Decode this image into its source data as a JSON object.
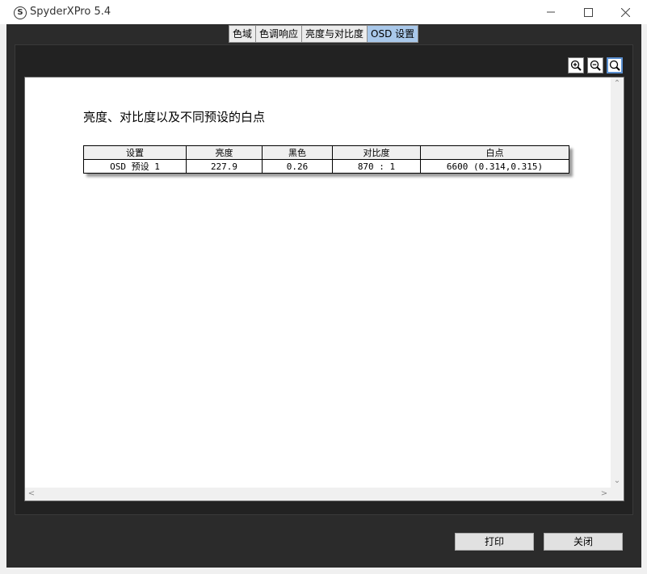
{
  "window": {
    "title": "SpyderXPro 5.4",
    "logo_letter": "S",
    "controls": [
      "minimize-icon",
      "maximize-icon",
      "close-icon"
    ]
  },
  "tabs": [
    {
      "label": "色域",
      "active": false
    },
    {
      "label": "色调响应",
      "active": false
    },
    {
      "label": "亮度与对比度",
      "active": false
    },
    {
      "label": "OSD 设置",
      "active": true
    }
  ],
  "zoom": {
    "icons": [
      "zoom-in-icon",
      "zoom-out-icon",
      "zoom-fit-icon"
    ]
  },
  "report": {
    "title": "亮度、对比度以及不同预设的白点",
    "table": {
      "headers": [
        "设置",
        "亮度",
        "黑色",
        "对比度",
        "白点"
      ],
      "rows": [
        [
          "OSD 预设 1",
          "227.9",
          "0.26",
          "870 : 1",
          "6600 (0.314,0.315)"
        ]
      ]
    }
  },
  "buttons": {
    "print": "打印",
    "close": "关闭"
  },
  "colors": {
    "active_tab": "#a9c8ea",
    "client_bg": "#2b2b2b",
    "report_bg": "#ffffff"
  }
}
